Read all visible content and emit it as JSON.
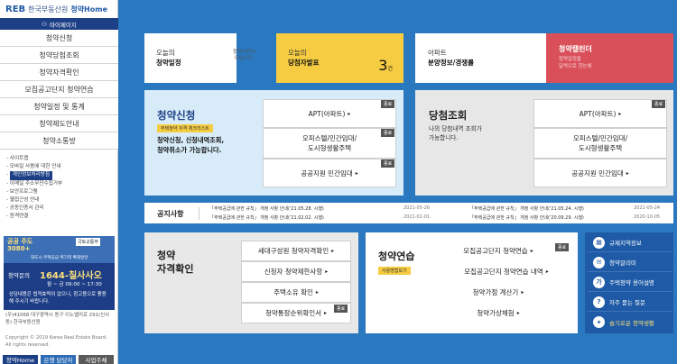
{
  "header": {
    "logo_mark": "REB",
    "logo_org": "한국부동산원",
    "logo_home": "청약Home",
    "mypage": "마이페이지"
  },
  "sidebar": {
    "menu": [
      "청약신청",
      "청약당첨조회",
      "청약자격확인",
      "모집공고단지 청약연습",
      "청약일정 및 통계",
      "청약제도안내",
      "청약소통방"
    ],
    "links": [
      "사이트맵",
      "모바일 사용에 대한 안내",
      "개인정보처리방침",
      "이메일 주소무단수집거부",
      "보안프로그램",
      "웹접근성 안내",
      "공동인증서 관리",
      "원격연결"
    ],
    "banner_left": "공공 주도 3080+",
    "banner_right": "국토교통부",
    "banner_sub": "대도시 주택공급 획기적 확대방안",
    "call_label": "청약문의",
    "call_number": "1644-칠사사오",
    "call_hours": "월 ~ 금 09:00 ~ 17:30",
    "call_note": "상담내용은 법적효력이 없으니, 참고용으로 활용해 주시기 바랍니다.",
    "address": "(우)41068 대구광역시 동구 이노밸리로 291(신서동) 한국부동산원",
    "copyright": "Copyright © 2019 Korea Real Estate Board. All rights reserved.",
    "bottom": [
      "청약Home",
      "은행 담당자",
      "사업주체"
    ]
  },
  "top": {
    "schedule_1": "오늘의",
    "schedule_2": "청약일정",
    "schedule_note_1": "청약시간이",
    "schedule_note_2": "아닙니다.",
    "winner_1": "오늘의",
    "winner_2": "당첨자발표",
    "winner_count": "3",
    "winner_unit": "건",
    "apt_1": "아파트",
    "apt_2": "분양정보/경쟁률",
    "cal_title": "청약캘린더",
    "cal_sub_1": "청약일정을",
    "cal_sub_2": "달력으로 한눈에"
  },
  "apply": {
    "title": "청약신청",
    "badge": "주택청약 자격 체크리스트",
    "desc_1": "청약신청, 신청내역조회,",
    "desc_2": "청약취소가 가능합니다.",
    "btn1": "APT(아파트)",
    "btn2_1": "오피스텔/민간임대/",
    "btn2_2": "도시형생활주택",
    "btn3": "공공지원 민간임대",
    "tag": "종료"
  },
  "winner": {
    "title": "당첨조회",
    "desc_1": "나의 당첨내역 조회가",
    "desc_2": "가능합니다.",
    "btn1": "APT(아파트)",
    "btn2_1": "오피스텔/민간임대/",
    "btn2_2": "도시형생활주택",
    "btn3": "공공지원 민간임대",
    "tag": "종료"
  },
  "notice": {
    "title": "공지사항",
    "items": [
      {
        "text": "「주택공급에 관한 규칙」 개정 사항 안내('21.05.28. 시행)",
        "date": "2021-05-26"
      },
      {
        "text": "「주택공급에 관한 규칙」 개정 사항 안내('21.02.02. 시행)",
        "date": "2021-02-01"
      },
      {
        "text": "「주택공급에 관한 규칙」 개정 사항 안내('21.05.24. 시행)",
        "date": "2021-05-24"
      },
      {
        "text": "「주택공급에 관한 규칙」 개정 사항 안내('20.09.29. 시행)",
        "date": "2020-10-05"
      }
    ]
  },
  "qualify": {
    "title_1": "청약",
    "title_2": "자격확인",
    "btn1": "세대구성원 청약자격확인",
    "btn2": "신청자 청약제한사항",
    "btn3": "주택소유 확인",
    "btn4": "청약통장순위확인서",
    "tag": "종료"
  },
  "practice": {
    "title": "청약연습",
    "badge": "사용방법보기",
    "btn1": "모집공고단지 청약연습",
    "btn2": "모집공고단지 청약연습 내역",
    "btn3": "청약가점 계산기",
    "btn4": "청약가상체험",
    "tag": "종료"
  },
  "quick": [
    "규제지역정보",
    "청약알리미",
    "주택청약 용어설명",
    "자주 묻는 질문",
    "슬기로운 청약생활"
  ],
  "quick_icons": [
    "map-icon",
    "mail-icon",
    "book-icon",
    "question-icon",
    "lightbulb-icon"
  ],
  "colors": {
    "main_bg": "#2a78c0",
    "yellow": "#f6cd42",
    "red": "#d9505b",
    "navy": "#1c3f86"
  }
}
